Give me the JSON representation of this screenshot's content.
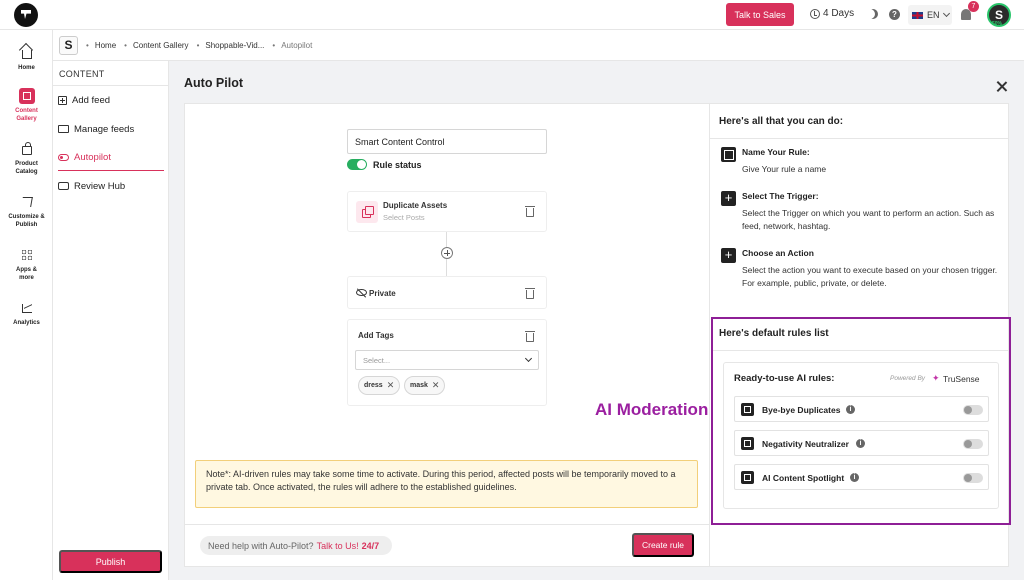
{
  "topbar": {
    "talk_to_sales": "Talk to Sales",
    "days": "4 Days",
    "language": "EN",
    "notifications_count": "7",
    "avatar_letter": "S",
    "profile_percent": "50%"
  },
  "leftnav": {
    "items": [
      {
        "label": "Home",
        "icon": "home-icon",
        "active": false
      },
      {
        "label": "Content Gallery",
        "icon": "gallery-icon",
        "active": true
      },
      {
        "label": "Product Catalog",
        "icon": "bag-icon",
        "active": false
      },
      {
        "label": "Customize & Publish",
        "icon": "send-icon",
        "active": false
      },
      {
        "label": "Apps & more",
        "icon": "apps-icon",
        "active": false
      },
      {
        "label": "Analytics",
        "icon": "analytics-icon",
        "active": false
      }
    ]
  },
  "breadcrumb": {
    "site_letter": "S",
    "items": [
      "Home",
      "Content Gallery",
      "Shoppable-Vid...",
      "Autopilot"
    ]
  },
  "subnav": {
    "title": "CONTENT",
    "items": [
      {
        "label": "Add feed",
        "icon": "add-feed-icon"
      },
      {
        "label": "Manage feeds",
        "icon": "truck-icon"
      },
      {
        "label": "Autopilot",
        "icon": "toggle-icon",
        "active": true
      },
      {
        "label": "Review Hub",
        "icon": "review-icon"
      }
    ],
    "publish": "Publish"
  },
  "autopilot": {
    "title": "Auto Pilot",
    "rule_name": "Smart Content Control",
    "rule_status_label": "Rule status",
    "rule_status_on": true,
    "trigger": {
      "title": "Duplicate Assets",
      "subtitle": "Select Posts"
    },
    "action_private": "Private",
    "add_tags": {
      "title": "Add Tags",
      "placeholder": "Select...",
      "tags": [
        "dress",
        "mask"
      ]
    },
    "overlay_label": "AI Moderation",
    "note": "Note*: AI-driven rules may take some time to activate. During this period, affected posts will be temporarily moved to a private tab. Once activated, the rules will adhere to the established guidelines.",
    "help": {
      "text": "Need help with Auto-Pilot?",
      "link": "Talk to Us!",
      "hours": "24/7"
    },
    "create_rule": "Create rule"
  },
  "info_panel": {
    "title": "Here's all that you can do:",
    "items": [
      {
        "icon": "edit-icon",
        "head": "Name Your Rule:",
        "text": "Give Your rule a name"
      },
      {
        "icon": "plus-icon",
        "head": "Select The Trigger:",
        "text": "Select the Trigger on which you want to perform an action. Such as feed, network, hashtag."
      },
      {
        "icon": "plus-icon",
        "head": "Choose an Action",
        "text": "Select the action you want to execute based on your chosen trigger. For example, public, private, or delete."
      }
    ]
  },
  "default_rules": {
    "title": "Here's default rules list",
    "ready_label": "Ready-to-use AI rules:",
    "powered_by": "Powered By",
    "brand": "TruSense",
    "rules": [
      {
        "label": "Bye-bye Duplicates",
        "enabled": false
      },
      {
        "label": "Negativity Neutralizer",
        "enabled": false
      },
      {
        "label": "AI Content Spotlight",
        "enabled": false
      }
    ]
  },
  "colors": {
    "accent": "#d8315b",
    "highlight_border": "#8e1f96",
    "toggle_on": "#27ae60"
  }
}
